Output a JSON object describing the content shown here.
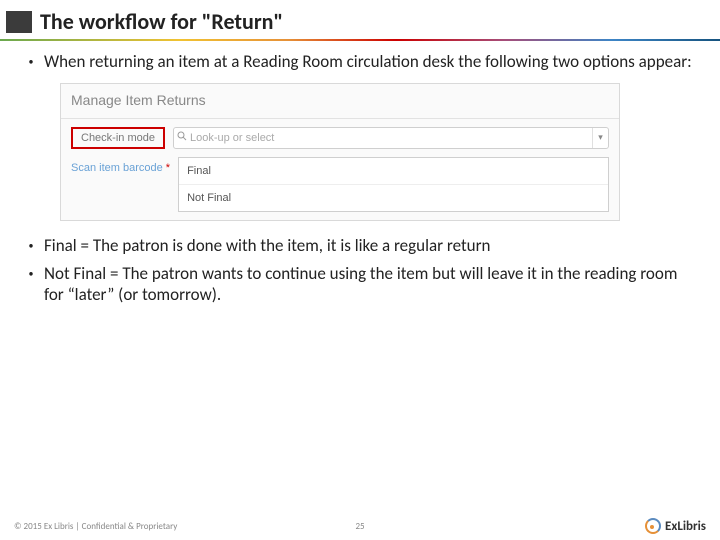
{
  "title": "The workflow for \"Return\"",
  "intro_bullet": "When returning an item at a Reading Room circulation desk the following two options appear:",
  "screenshot": {
    "heading": "Manage Item Returns",
    "checkin_label": "Check-in mode",
    "lookup_placeholder": "Look-up or select",
    "scan_label": "Scan item barcode",
    "options": [
      "Final",
      "Not Final"
    ]
  },
  "explain_bullets": [
    "Final = The patron is done with the item, it is like a regular return",
    "Not Final = The patron wants to continue using the item but will leave it in the reading room for “later” (or tomorrow)."
  ],
  "footer": {
    "copyright": "© 2015 Ex Libris | Confidential & Proprietary",
    "page": "25",
    "logo_text": "ExLibris"
  }
}
